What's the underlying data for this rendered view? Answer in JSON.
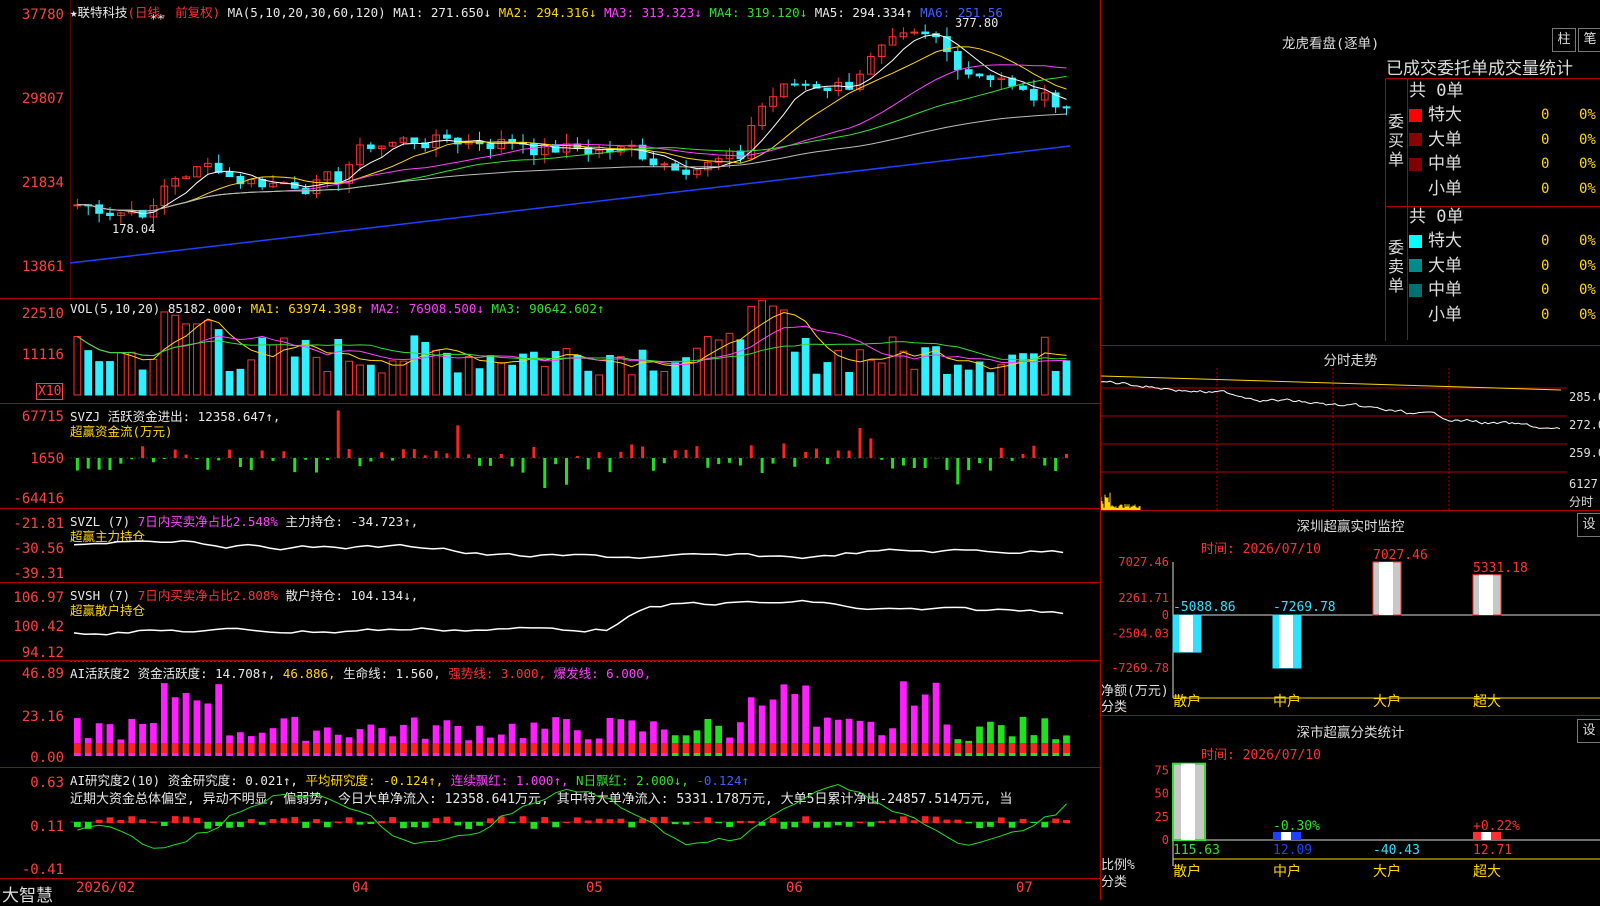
{
  "main_chart": {
    "header": {
      "stock": "★联特科技",
      "period": "(日线, 前复权)",
      "ma_params": "MA(5,10,20,30,60,120)",
      "ma1": "MA1: 271.650↓",
      "ma2": "MA2: 294.316↓",
      "ma3": "MA3: 313.323↓",
      "ma4": "MA4: 319.120↓",
      "ma5": "MA5: 294.334↑",
      "ma6": "MA6: 251.56"
    },
    "y_labels": [
      "37780",
      "29807",
      "21834",
      "13861"
    ],
    "high_marker": "377.80",
    "low_marker": "178.04",
    "stars": "**"
  },
  "vol_panel": {
    "header": "VOL(5,10,20)",
    "value": "85182.000↑",
    "ma1": "MA1: 63974.398↑",
    "ma2": "MA2: 76908.500↓",
    "ma3": "MA3: 90642.602↑",
    "y_labels": [
      "22510",
      "11116"
    ],
    "multiplier": "X10"
  },
  "svzj_panel": {
    "header": "SVZJ  活跃资金进出: 12358.647↑,",
    "subtitle": "超赢资金流(万元)",
    "y_labels": [
      "67715",
      "1650",
      "-64416"
    ]
  },
  "svzl_panel": {
    "name": "SVZL (7)",
    "ratio": "7日内买卖净占比2.548%",
    "hold": "主力持仓: -34.723↑,",
    "subtitle": "超赢主力持仓",
    "y_labels": [
      "-21.81",
      "-30.56",
      "-39.31"
    ]
  },
  "svsh_panel": {
    "name": "SVSH (7)",
    "ratio": "7日内买卖净占比2.808%",
    "hold": "散户持仓: 104.134↓,",
    "subtitle": "超赢散户持仓",
    "y_labels": [
      "106.97",
      "100.42",
      "94.12"
    ]
  },
  "ai_active_panel": {
    "name": "AI活跃度2",
    "active": "资金活跃度: 14.708↑,",
    "v2": "46.886,",
    "life": "生命线: 1.560,",
    "strong": "强势线: 3.000,",
    "burst": "爆发线: 6.000,",
    "y_labels": [
      "46.89",
      "23.16",
      "0.00"
    ]
  },
  "ai_research_panel": {
    "name": "AI研究度2(10)",
    "research": "资金研究度: 0.021↑,",
    "avg": "平均研究度: -0.124↑,",
    "red": "连续飘红: 1.000↑,",
    "nred": "N日飘红: 2.000↓,",
    "last": "-0.124↑",
    "comment": "近期大资金总体偏空, 异动不明显, 偏弱势, 今日大单净流入: 12358.641万元, 其中特大单净流入: 5331.178万元, 大单5日累计净出-24857.514万元, 当",
    "y_labels": [
      "0.63",
      "0.11",
      "-0.41"
    ]
  },
  "x_axis": {
    "brand": "大智慧",
    "labels": [
      "2026/02",
      "04",
      "05",
      "06",
      "07"
    ]
  },
  "dragon_tiger": {
    "title": "龙虎看盘(逐单)",
    "btn_bar": "柱",
    "btn_line": "笔",
    "subtitle": "已成交委托单成交量统计",
    "buy_label": "委买单",
    "sell_label": "委卖单",
    "buy_total": "共 0单",
    "sell_total": "共 0单",
    "buy_rows": [
      {
        "label": "特大",
        "value": "0",
        "pct": "0%",
        "color": "#ff0000"
      },
      {
        "label": "大单",
        "value": "0",
        "pct": "0%",
        "color": "#8b0000"
      },
      {
        "label": "中单",
        "value": "0",
        "pct": "0%",
        "color": "#800000"
      },
      {
        "label": "小单",
        "value": "0",
        "pct": "0%",
        "color": "#000000"
      }
    ],
    "sell_rows": [
      {
        "label": "特大",
        "value": "0",
        "pct": "0%",
        "color": "#00ffff"
      },
      {
        "label": "大单",
        "value": "0",
        "pct": "0%",
        "color": "#008b8b"
      },
      {
        "label": "中单",
        "value": "0",
        "pct": "0%",
        "color": "#007070"
      },
      {
        "label": "小单",
        "value": "0",
        "pct": "0%",
        "color": "#000000"
      }
    ]
  },
  "intraday": {
    "title": "分时走势",
    "y_labels": [
      "285.0",
      "272.0",
      "259.0"
    ],
    "vol_label": "6127",
    "vol_unit": "分时"
  },
  "realtime_monitor": {
    "title": "深圳超赢实时监控",
    "btn": "设",
    "time": "时间: 2026/07/10",
    "y_labels": [
      "7027.46",
      "2261.71",
      "0",
      "-2504.03",
      "-7269.78"
    ],
    "unit": "净额(万元)",
    "cat_label": "分类",
    "chart_data": {
      "type": "bar",
      "categories": [
        "散户",
        "中户",
        "大户",
        "超大"
      ],
      "values": [
        -5088.86,
        -7269.78,
        7027.46,
        5331.18
      ],
      "ylim": [
        -7269.78,
        7027.46
      ]
    }
  },
  "classify_stats": {
    "title": "深市超赢分类统计",
    "btn": "设",
    "time": "时间: 2026/07/10",
    "y_labels": [
      "75",
      "50",
      "25",
      "0"
    ],
    "unit": "比例%",
    "cat_label": "分类",
    "chart_data": {
      "type": "bar",
      "categories": [
        "散户",
        "中户",
        "大户",
        "超大"
      ],
      "values": [
        115.63,
        12.09,
        -40.43,
        12.71
      ],
      "pct_labels": [
        "",
        "-0.30%",
        "",
        "+0.22%"
      ]
    }
  },
  "colors": {
    "up": "#ff3030",
    "down": "#30f0ff",
    "axis": "#b00000",
    "accent": "#ffd700"
  }
}
